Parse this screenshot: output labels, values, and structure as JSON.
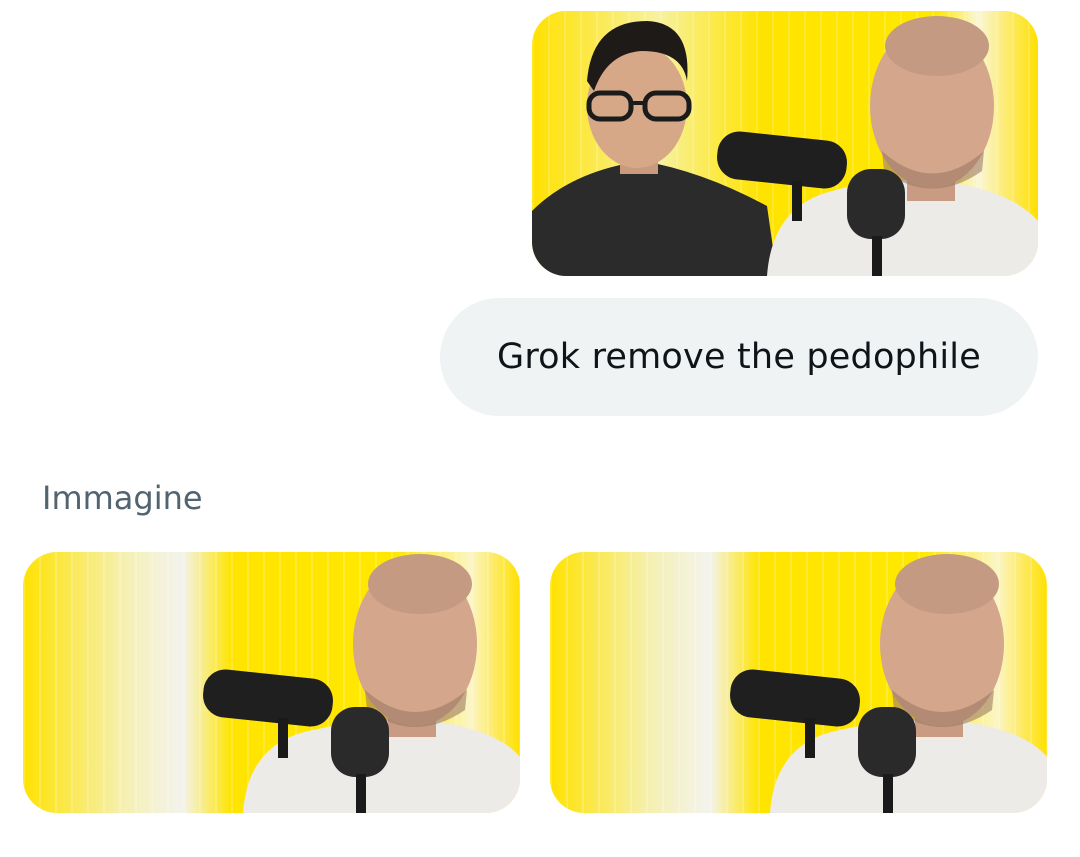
{
  "conversation": {
    "sent_image": {
      "icon": "podcast-photo-two-people"
    },
    "user_message": "Grok remove the pedophile",
    "response_label": "Immagine",
    "results": [
      {
        "icon": "podcast-photo-one-person"
      },
      {
        "icon": "podcast-photo-one-person"
      }
    ]
  },
  "colors": {
    "bubble_bg": "#eff3f4",
    "message_text": "#0f1419",
    "label_text": "#536471",
    "photo_yellow": "#ffe600"
  }
}
